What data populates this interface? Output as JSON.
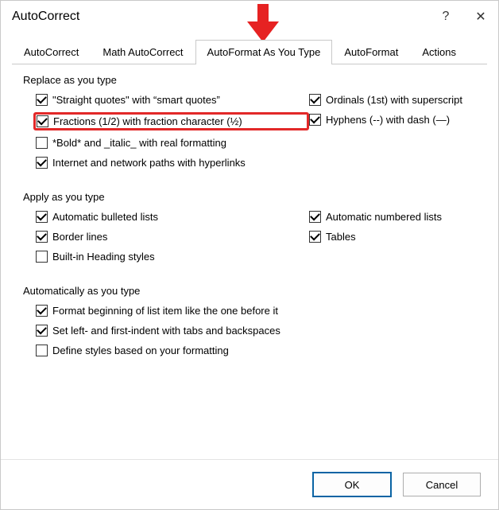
{
  "window": {
    "title": "AutoCorrect",
    "help_label": "?",
    "close_label": "✕"
  },
  "tabs": {
    "autocorrect": "AutoCorrect",
    "math": "Math AutoCorrect",
    "autoformat_type": "AutoFormat As You Type",
    "autoformat": "AutoFormat",
    "actions": "Actions"
  },
  "groups": {
    "replace": {
      "title": "Replace as you type",
      "straight_quotes": "\"Straight quotes\" with “smart quotes”",
      "fractions": "Fractions (1/2) with fraction character (½)",
      "bold_italic": "*Bold* and _italic_ with real formatting",
      "internet": "Internet and network paths with hyperlinks",
      "ordinals": "Ordinals (1st) with superscript",
      "hyphens": "Hyphens (--) with dash (—)"
    },
    "apply": {
      "title": "Apply as you type",
      "auto_bulleted": "Automatic bulleted lists",
      "border_lines": "Border lines",
      "heading_styles": "Built-in Heading styles",
      "auto_numbered": "Automatic numbered lists",
      "tables": "Tables"
    },
    "auto": {
      "title": "Automatically as you type",
      "format_beginning": "Format beginning of list item like the one before it",
      "set_indent": "Set left- and first-indent with tabs and backspaces",
      "define_styles": "Define styles based on your formatting"
    }
  },
  "buttons": {
    "ok": "OK",
    "cancel": "Cancel"
  }
}
